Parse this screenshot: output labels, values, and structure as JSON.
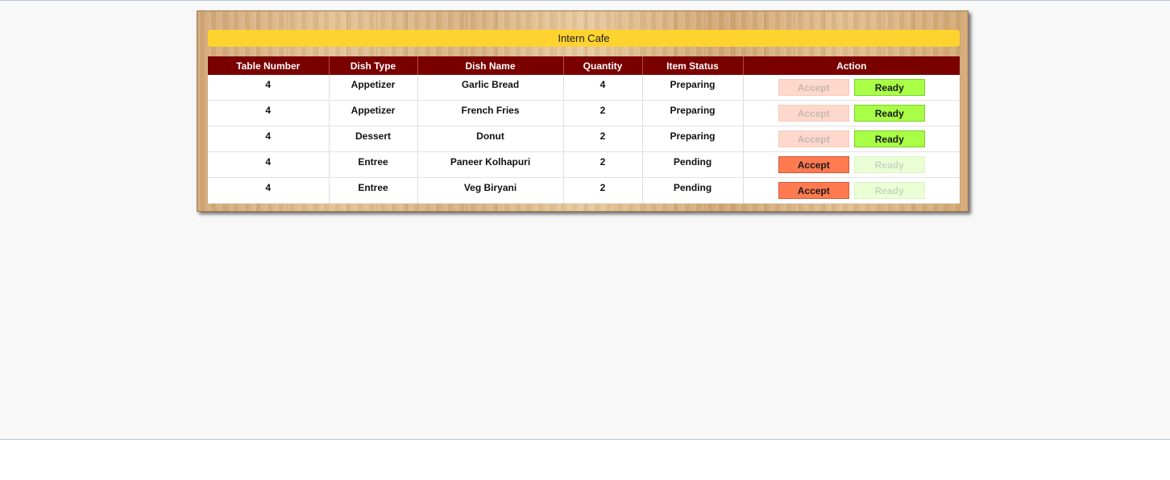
{
  "app": {
    "title": "Intern Cafe"
  },
  "table": {
    "headers": [
      "Table Number",
      "Dish Type",
      "Dish Name",
      "Quantity",
      "Item Status",
      "Action"
    ],
    "rows": [
      {
        "table_number": "4",
        "dish_type": "Appetizer",
        "dish_name": "Garlic Bread",
        "quantity": "4",
        "status": "Preparing",
        "accept_label": "Accept",
        "ready_label": "Ready",
        "accept_enabled": false,
        "ready_enabled": true
      },
      {
        "table_number": "4",
        "dish_type": "Appetizer",
        "dish_name": "French Fries",
        "quantity": "2",
        "status": "Preparing",
        "accept_label": "Accept",
        "ready_label": "Ready",
        "accept_enabled": false,
        "ready_enabled": true
      },
      {
        "table_number": "4",
        "dish_type": "Dessert",
        "dish_name": "Donut",
        "quantity": "2",
        "status": "Preparing",
        "accept_label": "Accept",
        "ready_label": "Ready",
        "accept_enabled": false,
        "ready_enabled": true
      },
      {
        "table_number": "4",
        "dish_type": "Entree",
        "dish_name": "Paneer Kolhapuri",
        "quantity": "2",
        "status": "Pending",
        "accept_label": "Accept",
        "ready_label": "Ready",
        "accept_enabled": true,
        "ready_enabled": false
      },
      {
        "table_number": "4",
        "dish_type": "Entree",
        "dish_name": "Veg Biryani",
        "quantity": "2",
        "status": "Pending",
        "accept_label": "Accept",
        "ready_label": "Ready",
        "accept_enabled": true,
        "ready_enabled": false
      }
    ]
  },
  "colors": {
    "title_bar": "#fed32f",
    "header_bg": "#7a0000",
    "accept_active": "#ff7a50",
    "accept_disabled": "#ffd8cc",
    "ready_active": "#a8ff45",
    "ready_disabled": "#ebffd6"
  }
}
